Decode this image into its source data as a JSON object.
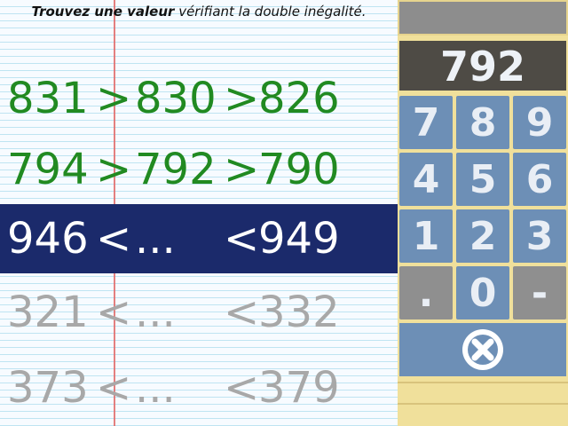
{
  "instruction": {
    "bold_part": "Trouvez une valeur",
    "rest_part": "vérifiant la double inégalité."
  },
  "rows": [
    {
      "state": "solved",
      "a": "831",
      "op1": ">",
      "mid": "830",
      "op2": ">",
      "b": "826"
    },
    {
      "state": "solved",
      "a": "794",
      "op1": ">",
      "mid": "792",
      "op2": ">",
      "b": "790"
    },
    {
      "state": "active",
      "a": "946",
      "op1": "<",
      "mid": "...",
      "op2": "<",
      "b": "949"
    },
    {
      "state": "pending",
      "a": "321",
      "op1": "<",
      "mid": "...",
      "op2": "<",
      "b": "332"
    },
    {
      "state": "pending",
      "a": "373",
      "op1": "<",
      "mid": "...",
      "op2": "<",
      "b": "379"
    }
  ],
  "display": {
    "value": "792"
  },
  "keypad": {
    "keys": [
      "7",
      "8",
      "9",
      "4",
      "5",
      "6",
      "1",
      "2",
      "3",
      ".",
      "0",
      "-"
    ],
    "clear_icon": "clear-circle-x-icon"
  },
  "colors": {
    "solved": "#218a21",
    "active_bg": "#1b2a6b",
    "pending": "#a8a8a8",
    "key_blue": "#6d8fb6",
    "key_gray": "#8f8f8f",
    "display_bg": "#4e4b45",
    "panel_bg": "#f0e09b"
  }
}
